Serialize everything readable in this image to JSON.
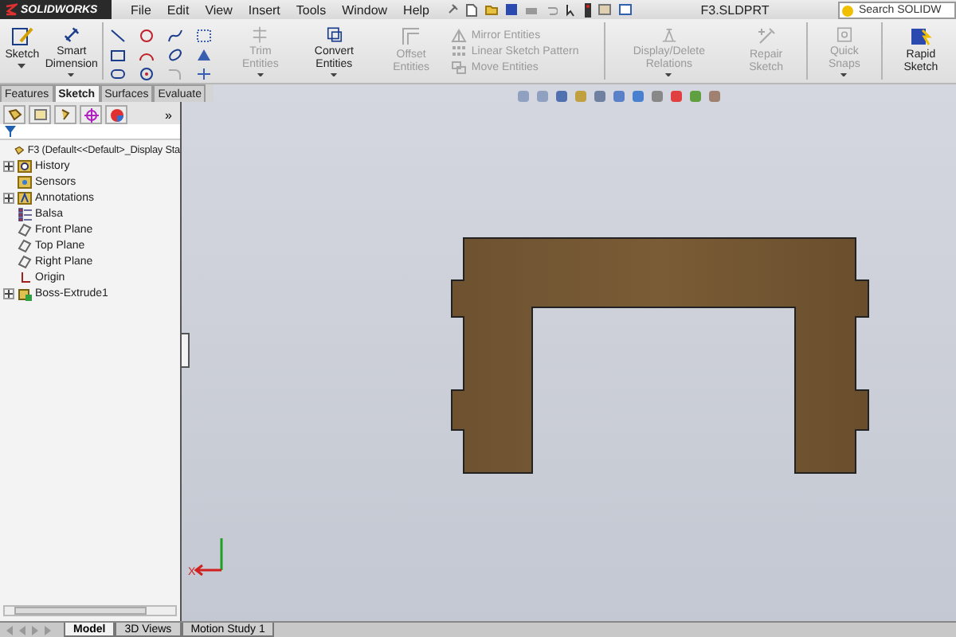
{
  "app": {
    "brand": "SOLIDWORKS",
    "menu": [
      "File",
      "Edit",
      "View",
      "Insert",
      "Tools",
      "Window",
      "Help"
    ],
    "document_title": "F3.SLDPRT",
    "search": {
      "placeholder": "Search SOLIDW"
    }
  },
  "command_manager": {
    "big_buttons": [
      {
        "label": "Sketch",
        "kind": "sketch",
        "disabled": false,
        "caret": true
      },
      {
        "label": "Smart Dimension",
        "kind": "dimension",
        "disabled": false,
        "caret": true
      }
    ],
    "tool_buttons": [
      {
        "label": "Trim Entities",
        "kind": "trim",
        "disabled": true,
        "caret": true
      },
      {
        "label": "Convert Entities",
        "kind": "convert",
        "disabled": false,
        "caret": true
      },
      {
        "label": "Offset Entities",
        "kind": "offset",
        "disabled": true,
        "caret": false
      }
    ],
    "small_buttons": [
      {
        "label": "Mirror Entities",
        "kind": "mirror",
        "disabled": true
      },
      {
        "label": "Linear Sketch Pattern",
        "kind": "pattern",
        "disabled": true
      },
      {
        "label": "Move Entities",
        "kind": "move",
        "disabled": true
      }
    ],
    "right_buttons": [
      {
        "label": "Display/Delete Relations",
        "kind": "relations",
        "disabled": true,
        "caret": true
      },
      {
        "label": "Repair Sketch",
        "kind": "repair",
        "disabled": true,
        "caret": false
      },
      {
        "label": "Quick Snaps",
        "kind": "snaps",
        "disabled": true,
        "caret": true
      },
      {
        "label": "Rapid Sketch",
        "kind": "rapid",
        "disabled": false,
        "caret": false
      }
    ]
  },
  "tabs": [
    {
      "label": "Features",
      "selected": false
    },
    {
      "label": "Sketch",
      "selected": true
    },
    {
      "label": "Surfaces",
      "selected": false
    },
    {
      "label": "Evaluate",
      "selected": false
    }
  ],
  "feature_tree": {
    "more": "»",
    "root": {
      "label": "F3  (Default<<Default>_Display Sta",
      "children": [
        {
          "label": "History",
          "kind": "history",
          "expander": true
        },
        {
          "label": "Sensors",
          "kind": "sensors",
          "expander": false
        },
        {
          "label": "Annotations",
          "kind": "annotations",
          "expander": true
        },
        {
          "label": "Balsa",
          "kind": "material",
          "expander": false
        },
        {
          "label": "Front Plane",
          "kind": "plane",
          "expander": false
        },
        {
          "label": "Top Plane",
          "kind": "plane",
          "expander": false
        },
        {
          "label": "Right Plane",
          "kind": "plane",
          "expander": false
        },
        {
          "label": "Origin",
          "kind": "origin",
          "expander": false
        },
        {
          "label": "Boss-Extrude1",
          "kind": "extrude",
          "expander": true
        }
      ]
    }
  },
  "viewport": {
    "triad_label": "X"
  },
  "bottom_tabs": [
    {
      "label": "Model",
      "selected": true
    },
    {
      "label": "3D Views",
      "selected": false
    },
    {
      "label": "Motion Study 1",
      "selected": false
    }
  ]
}
